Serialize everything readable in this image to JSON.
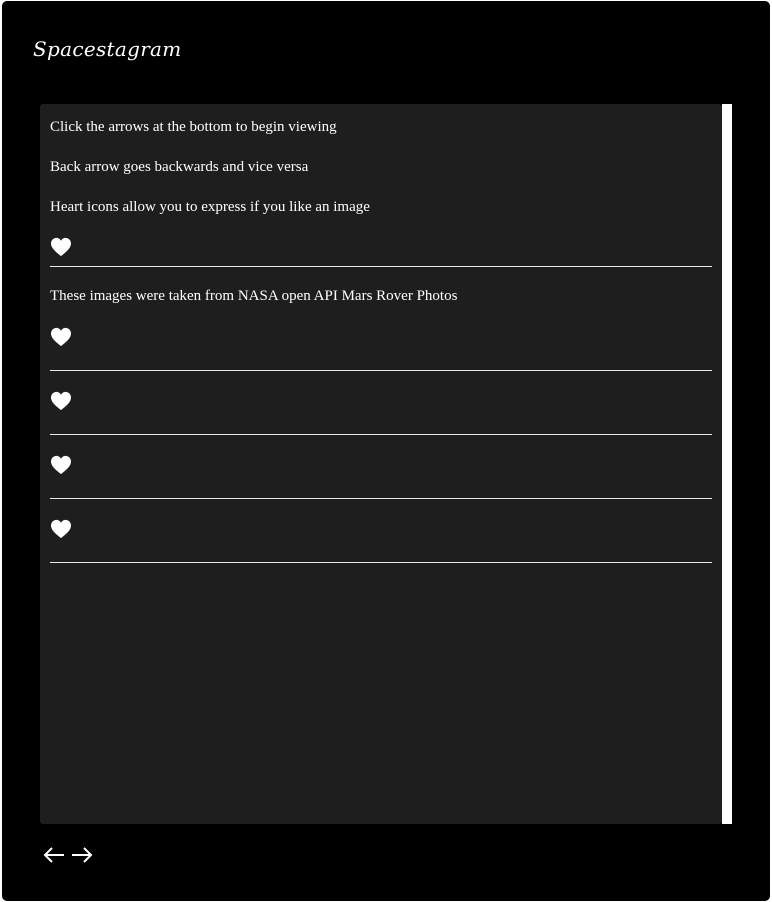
{
  "app": {
    "title": "Spacestagram"
  },
  "feed": {
    "posts": [
      {
        "lines": [
          "Click the arrows at the bottom to begin viewing",
          "Back arrow goes backwards and vice versa",
          "Heart icons allow you to express if you like an image"
        ],
        "liked": false
      },
      {
        "lines": [
          "These images were taken from NASA open API Mars Rover Photos"
        ],
        "liked": false
      },
      {
        "lines": [],
        "liked": false
      },
      {
        "lines": [],
        "liked": false
      },
      {
        "lines": [],
        "liked": false
      }
    ]
  },
  "navigation": {
    "back_icon": "arrow-left-icon",
    "forward_icon": "arrow-right-icon"
  },
  "icons": {
    "like": "heart-icon"
  },
  "colors": {
    "background": "#000000",
    "panel": "#1f1e1f",
    "text": "#ffffff",
    "divider": "#e8e8e8"
  }
}
